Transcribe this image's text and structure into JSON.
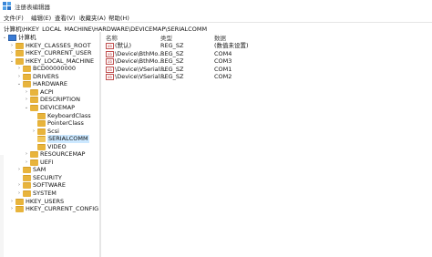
{
  "window": {
    "title": "注册表编辑器",
    "icon": "registry-editor-icon"
  },
  "menu": [
    "文件(F)",
    "编辑(E)",
    "查看(V)",
    "收藏夹(A)",
    "帮助(H)"
  ],
  "address": "计算机\\HKEY_LOCAL_MACHINE\\HARDWARE\\DEVICEMAP\\SERIALCOMM",
  "tree": [
    {
      "label": "计算机",
      "expander": "⌄",
      "icon": "computer-icon",
      "depth": 0
    },
    {
      "label": "HKEY_CLASSES_ROOT",
      "expander": "›",
      "icon": "folder-icon",
      "depth": 1
    },
    {
      "label": "HKEY_CURRENT_USER",
      "expander": "›",
      "icon": "folder-icon",
      "depth": 1
    },
    {
      "label": "HKEY_LOCAL_MACHINE",
      "expander": "⌄",
      "icon": "folder-icon",
      "depth": 1
    },
    {
      "label": "BCD00000000",
      "expander": "›",
      "icon": "folder-icon",
      "depth": 2
    },
    {
      "label": "DRIVERS",
      "expander": "›",
      "icon": "folder-icon",
      "depth": 2
    },
    {
      "label": "HARDWARE",
      "expander": "⌄",
      "icon": "folder-icon",
      "depth": 2
    },
    {
      "label": "ACPI",
      "expander": "›",
      "icon": "folder-icon",
      "depth": 3
    },
    {
      "label": "DESCRIPTION",
      "expander": "›",
      "icon": "folder-icon",
      "depth": 3
    },
    {
      "label": "DEVICEMAP",
      "expander": "⌄",
      "icon": "folder-icon",
      "depth": 3
    },
    {
      "label": "KeyboardClass",
      "expander": "",
      "icon": "folder-icon",
      "depth": 4
    },
    {
      "label": "PointerClass",
      "expander": "",
      "icon": "folder-icon",
      "depth": 4
    },
    {
      "label": "Scsi",
      "expander": "›",
      "icon": "folder-icon",
      "depth": 4
    },
    {
      "label": "SERIALCOMM",
      "expander": "",
      "icon": "folder-icon",
      "depth": 4,
      "selected": true
    },
    {
      "label": "VIDEO",
      "expander": "",
      "icon": "folder-icon",
      "depth": 4
    },
    {
      "label": "RESOURCEMAP",
      "expander": "›",
      "icon": "folder-icon",
      "depth": 3
    },
    {
      "label": "UEFI",
      "expander": "›",
      "icon": "folder-icon",
      "depth": 3
    },
    {
      "label": "SAM",
      "expander": "›",
      "icon": "folder-icon",
      "depth": 2
    },
    {
      "label": "SECURITY",
      "expander": "",
      "icon": "folder-icon",
      "depth": 2
    },
    {
      "label": "SOFTWARE",
      "expander": "›",
      "icon": "folder-icon",
      "depth": 2
    },
    {
      "label": "SYSTEM",
      "expander": "›",
      "icon": "folder-icon",
      "depth": 2
    },
    {
      "label": "HKEY_USERS",
      "expander": "›",
      "icon": "folder-icon",
      "depth": 1
    },
    {
      "label": "HKEY_CURRENT_CONFIG",
      "expander": "›",
      "icon": "folder-icon",
      "depth": 1
    }
  ],
  "list": {
    "headers": {
      "name": "名称",
      "type": "类型",
      "data": "数据"
    },
    "rows": [
      {
        "icon": "ab",
        "name": "(默认)",
        "type": "REG_SZ",
        "data": "(数值未设置)"
      },
      {
        "icon": "ab",
        "name": "\\Device\\BthMo...",
        "type": "REG_SZ",
        "data": "COM4"
      },
      {
        "icon": "ab",
        "name": "\\Device\\BthMo...",
        "type": "REG_SZ",
        "data": "COM3"
      },
      {
        "icon": "ab",
        "name": "\\Device\\VSerial...",
        "type": "REG_SZ",
        "data": "COM1"
      },
      {
        "icon": "ab",
        "name": "\\Device\\VSerial...",
        "type": "REG_SZ",
        "data": "COM2"
      }
    ]
  },
  "colors": {
    "folder": "#e8b43c",
    "selection": "#cce8ff",
    "computer": "#3a7bd5"
  }
}
